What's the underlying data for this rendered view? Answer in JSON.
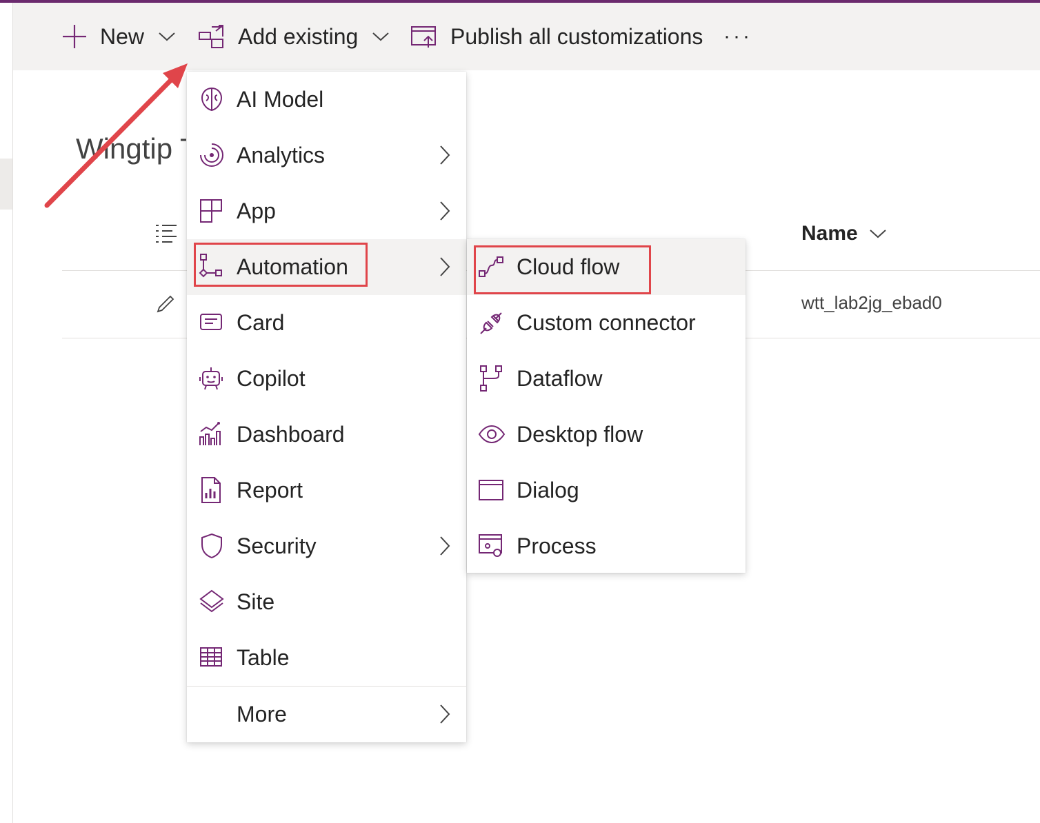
{
  "colors": {
    "accent": "#742774",
    "highlight": "#e0454a",
    "topline": "#6b2a6e"
  },
  "commandbar": {
    "new_label": "New",
    "add_existing_label": "Add existing",
    "publish_label": "Publish all customizations",
    "more_label": "···"
  },
  "page": {
    "title": "Wingtip T",
    "name_header": "Name",
    "row_name": "wtt_lab2jg_ebad0"
  },
  "menu": {
    "items": [
      {
        "label": "AI Model",
        "icon": "ai-model-icon"
      },
      {
        "label": "Analytics",
        "icon": "analytics-icon",
        "submenu": true
      },
      {
        "label": "App",
        "icon": "app-icon",
        "submenu": true
      },
      {
        "label": "Automation",
        "icon": "automation-icon",
        "submenu": true,
        "active": true
      },
      {
        "label": "Card",
        "icon": "card-icon"
      },
      {
        "label": "Copilot",
        "icon": "copilot-icon"
      },
      {
        "label": "Dashboard",
        "icon": "dashboard-icon"
      },
      {
        "label": "Report",
        "icon": "report-icon"
      },
      {
        "label": "Security",
        "icon": "security-icon",
        "submenu": true
      },
      {
        "label": "Site",
        "icon": "site-icon"
      },
      {
        "label": "Table",
        "icon": "table-icon"
      }
    ],
    "more_label": "More"
  },
  "submenu": {
    "items": [
      {
        "label": "Cloud flow",
        "icon": "cloud-flow-icon",
        "active": true
      },
      {
        "label": "Custom connector",
        "icon": "custom-connector-icon"
      },
      {
        "label": "Dataflow",
        "icon": "dataflow-icon"
      },
      {
        "label": "Desktop flow",
        "icon": "desktop-flow-icon"
      },
      {
        "label": "Dialog",
        "icon": "dialog-icon"
      },
      {
        "label": "Process",
        "icon": "process-icon"
      }
    ]
  }
}
